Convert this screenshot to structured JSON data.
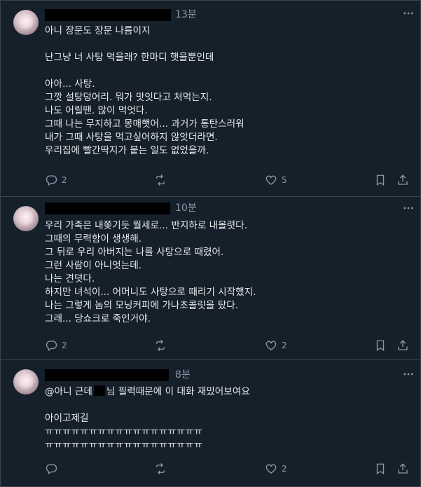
{
  "posts": [
    {
      "time": "13분",
      "more_icon": "more-icon",
      "lines": [
        "아니 장문도 장문 나름이지",
        "",
        "난그냥 너 사탕 먹을래? 한마디 햇을뿐인데",
        "",
        "아아... 사탕.",
        "그깟 설탕덩어리. 뭐가 맛잇다고 처먹는지.",
        "나도 어릴땐. 많이 먹엇다.",
        "그때 나는 무지하고 몽매햇어... 과거가 통탄스러워",
        "내가 그때 사탕을 먹고싶어하지 않앗더라면.",
        "우리집에 빨간딱지가 붙는 일도 없었을까."
      ],
      "replies": "2",
      "retweets": "",
      "likes": "5"
    },
    {
      "time": "10분",
      "lines": [
        "우리 가족은 내쫒기듯 월세로... 반지하로 내몰렷다.",
        "그때의 무력함이 생생해.",
        "그 뒤로 우리 아버지는 나를 사탕으로 때렸어.",
        "그런 사람이 아니엇는데.",
        "나는 견뎟다.",
        "하지만 녀석이... 어머니도 사탕으로 때리기 시작했지.",
        "나는 그렇게 놈의 모닝커피에 가나초콜릿을 탔다.",
        "그래... 당쇼크로 죽인거야."
      ],
      "replies": "2",
      "retweets": "",
      "likes": "2"
    },
    {
      "time": "8분",
      "line1_before": "@아니 근데",
      "line1_after": "님 필력때문에 이 대화 재밌어보여요",
      "lines": [
        "",
        "아이고제길",
        "ㅠㅠㅠㅠㅠㅠㅠㅠㅠㅠㅠㅠㅠㅠㅠㅠㅠㅠ",
        "ㅠㅠㅠㅠㅠㅠㅠㅠㅠㅠㅠㅠㅠㅠㅠㅠㅠㅠ"
      ],
      "replies": "",
      "retweets": "",
      "likes": "2"
    }
  ],
  "colors": {
    "background": "#15202b",
    "text": "#e7e9ea",
    "muted": "#8b98a5",
    "border": "#38444d"
  }
}
